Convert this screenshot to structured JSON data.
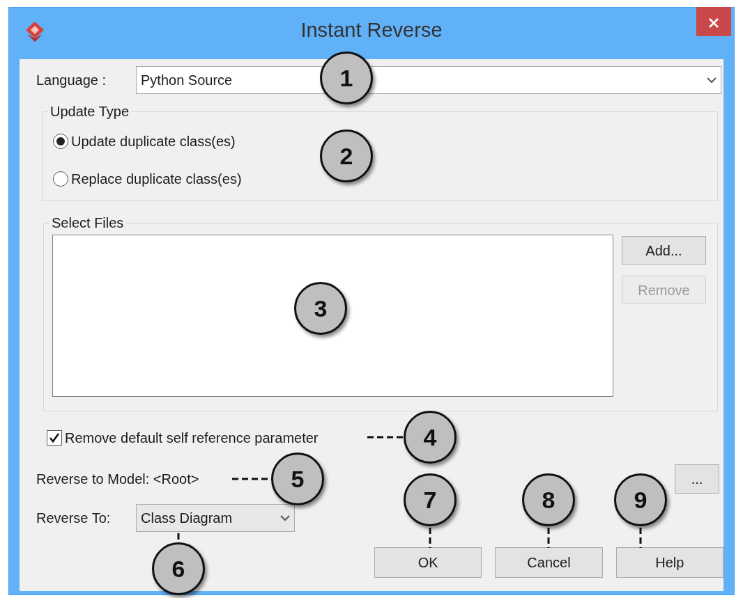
{
  "window": {
    "title": "Instant Reverse"
  },
  "language": {
    "label": "Language :",
    "value": "Python Source"
  },
  "update_type": {
    "title": "Update Type",
    "options": [
      {
        "label": "Update duplicate class(es)",
        "selected": true
      },
      {
        "label": "Replace duplicate class(es)",
        "selected": false
      }
    ]
  },
  "select_files": {
    "title": "Select Files",
    "buttons": [
      {
        "label": "Add...",
        "disabled": false
      },
      {
        "label": "Remove",
        "disabled": true
      }
    ]
  },
  "remove_self": {
    "label": "Remove default self reference parameter",
    "checked": true
  },
  "reverse_to_model": {
    "label": "Reverse to Model:",
    "value": "<Root>",
    "browse": "..."
  },
  "reverse_to": {
    "label": "Reverse To:",
    "value": "Class Diagram"
  },
  "buttons": [
    "OK",
    "Cancel",
    "Help"
  ],
  "callouts": [
    "1",
    "2",
    "3",
    "4",
    "5",
    "6",
    "7",
    "8",
    "9"
  ]
}
